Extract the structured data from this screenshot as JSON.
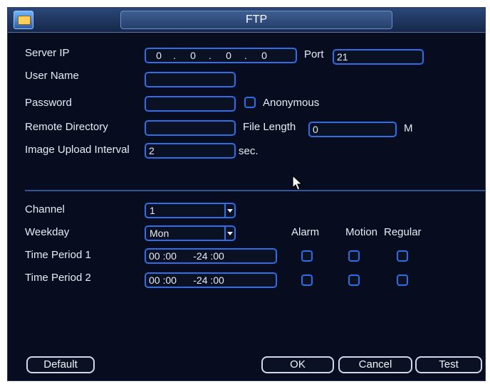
{
  "window": {
    "title": "FTP"
  },
  "server": {
    "ip_label": "Server IP",
    "ip": [
      "0",
      "0",
      "0",
      "0"
    ],
    "port_label": "Port",
    "port_value": "21",
    "username_label": "User Name",
    "username_value": "",
    "password_label": "Password",
    "password_value": "",
    "anonymous_label": "Anonymous",
    "anonymous_checked": false,
    "remote_dir_label": "Remote Directory",
    "remote_dir_value": "",
    "file_length_label": "File Length",
    "file_length_value": "0",
    "file_length_unit": "M",
    "upload_interval_label": "Image Upload Interval",
    "upload_interval_value": "2",
    "upload_interval_unit": "sec."
  },
  "schedule": {
    "channel_label": "Channel",
    "channel_value": "1",
    "weekday_label": "Weekday",
    "weekday_value": "Mon",
    "column_headers": [
      "Alarm",
      "Motion",
      "Regular"
    ],
    "periods": [
      {
        "label": "Time Period 1",
        "value": "00 :00      -24 :00",
        "alarm": false,
        "motion": false,
        "regular": false
      },
      {
        "label": "Time Period 2",
        "value": "00 :00      -24 :00",
        "alarm": false,
        "motion": false,
        "regular": false
      }
    ]
  },
  "buttons": {
    "default": "Default",
    "ok": "OK",
    "cancel": "Cancel",
    "test": "Test"
  },
  "colors": {
    "background": "#070d1e",
    "accent": "#2e6ee6",
    "text": "#e7ebf3"
  },
  "icons": {
    "title": "ftp-app-icon",
    "cursor": "mouse-pointer-icon"
  }
}
